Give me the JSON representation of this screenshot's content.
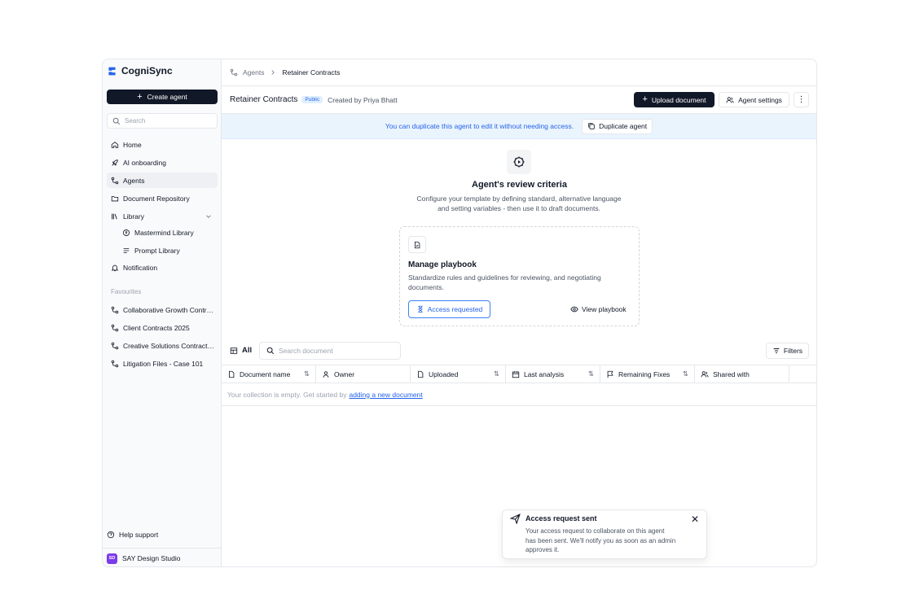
{
  "sidebar": {
    "brand": "CogniSync",
    "create_label": "Create agent",
    "search_placeholder": "Search",
    "nav": {
      "home": "Home",
      "ai_onboarding": "AI onboarding",
      "agents": "Agents",
      "document_repository": "Document Repository",
      "library": "Library",
      "mastermind_library": "Mastermind Library",
      "prompt_library": "Prompt Library",
      "notification": "Notification"
    },
    "favourites_title": "Favourites",
    "favourites": [
      "Collaborative Growth Contr…",
      "Client Contracts 2025",
      "Creative Solutions Contract…",
      "Litigation Files - Case 101"
    ],
    "help": "Help support",
    "workspace_initials": "SD",
    "workspace_name": "SAY Design Studio"
  },
  "breadcrumb": {
    "parent": "Agents",
    "current": "Retainer Contracts"
  },
  "header": {
    "title": "Retainer Contracts",
    "badge": "Public",
    "created_by": "Created by Priya Bhatt",
    "upload_label": "Upload document",
    "settings_label": "Agent settings"
  },
  "banner": {
    "text": "You can duplicate this agent to edit it without needing access.",
    "button": "Duplicate agent"
  },
  "review": {
    "title": "Agent's review criteria",
    "desc_line1": "Configure your template by defining standard, alternative language",
    "desc_line2": "and setting variables - then use it to draft documents."
  },
  "playbook": {
    "title": "Manage playbook",
    "desc": "Standardize rules and guidelines for reviewing, and negotiating documents.",
    "access_label": "Access requested",
    "view_label": "View playbook"
  },
  "table": {
    "filter_all": "All",
    "search_placeholder": "Search document",
    "filters_label": "Filters",
    "columns": {
      "document_name": "Document name",
      "owner": "Owner",
      "uploaded": "Uploaded",
      "last_analysis": "Last analysis",
      "remaining_fixes": "Remaining Fixes",
      "shared_with": "Shared with"
    },
    "empty_text": "Your collection is empty. Get started by",
    "empty_link": "adding a new document"
  },
  "toast": {
    "title": "Access request sent",
    "text": "Your access request to collaborate on this agent has been sent. We'll notify you as soon as an admin approves it."
  },
  "colors": {
    "primary_dark": "#111827",
    "accent_blue": "#2563eb",
    "banner_bg": "#eaf4fd",
    "workspace_avatar": "#7c3aed"
  }
}
